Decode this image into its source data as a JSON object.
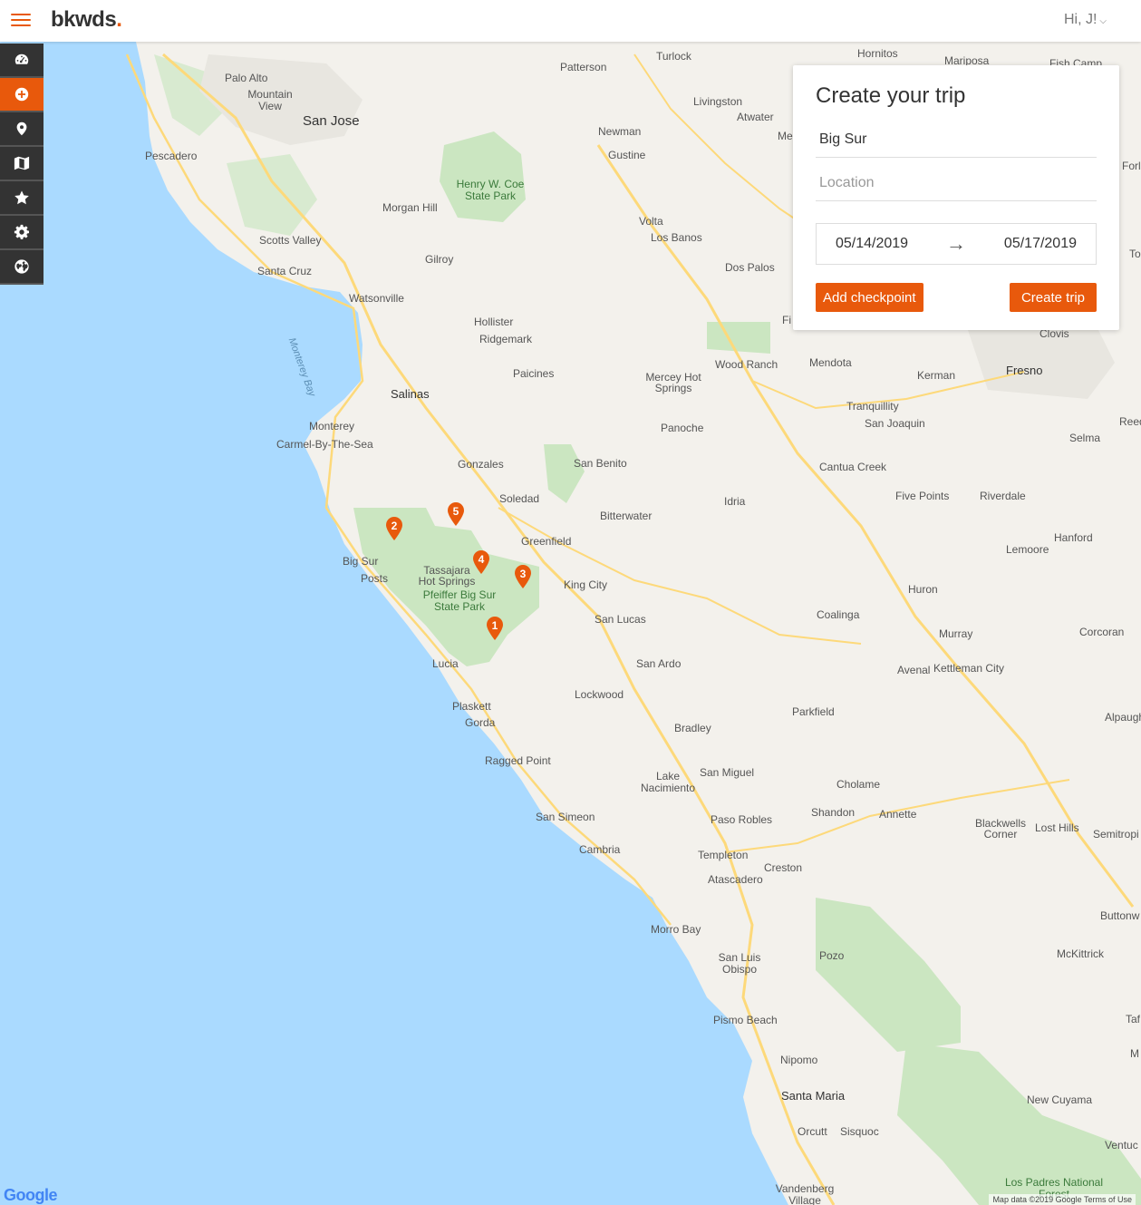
{
  "header": {
    "menu_icon": "hamburger-icon",
    "logo_text": "bkwds",
    "logo_dot": ".",
    "greeting": "Hi, J!",
    "accent_color": "#e8590c"
  },
  "sidebar": {
    "items": [
      {
        "name": "dashboard",
        "icon": "speedometer-icon",
        "active": false
      },
      {
        "name": "create-trip",
        "icon": "plus-circle-icon",
        "active": true
      },
      {
        "name": "locations",
        "icon": "map-marker-icon",
        "active": false
      },
      {
        "name": "maps",
        "icon": "map-icon",
        "active": false
      },
      {
        "name": "favorites",
        "icon": "star-icon",
        "active": false
      },
      {
        "name": "settings",
        "icon": "gear-icon",
        "active": false
      },
      {
        "name": "explore",
        "icon": "globe-icon",
        "active": false
      }
    ]
  },
  "trip_panel": {
    "title": "Create your trip",
    "trip_name_value": "Big Sur",
    "location_placeholder": "Location",
    "start_date": "05/14/2019",
    "end_date": "05/17/2019",
    "arrow": "→",
    "add_checkpoint_label": "Add checkpoint",
    "create_trip_label": "Create trip"
  },
  "map": {
    "pins": [
      "1",
      "2",
      "3",
      "4",
      "5"
    ],
    "labels": {
      "turlock": "Turlock",
      "patterson": "Patterson",
      "palo_alto": "Palo Alto",
      "mountain_view": "Mountain View",
      "san_jose": "San Jose",
      "pescadero": "Pescadero",
      "morgan_hill": "Morgan Hill",
      "henry_coe": "Henry W. Coe State Park",
      "scotts_valley": "Scotts Valley",
      "santa_cruz": "Santa Cruz",
      "gilroy": "Gilroy",
      "watsonville": "Watsonville",
      "hollister": "Hollister",
      "ridgemark": "Ridgemark",
      "monterey_bay": "Monterey Bay",
      "paicines": "Paicines",
      "salinas": "Salinas",
      "monterey": "Monterey",
      "carmel": "Carmel-By-The-Sea",
      "gonzales": "Gonzales",
      "soledad": "Soledad",
      "san_benito": "San Benito",
      "bitterwater": "Bitterwater",
      "greenfield": "Greenfield",
      "big_sur": "Big Sur",
      "posts": "Posts",
      "tassajara": "Tassajara Hot Springs",
      "pfeiffer": "Pfeiffer Big Sur State Park",
      "king_city": "King City",
      "san_lucas": "San Lucas",
      "lucia": "Lucia",
      "san_ardo": "San Ardo",
      "lockwood": "Lockwood",
      "plaskett": "Plaskett",
      "gorda": "Gorda",
      "ragged_point": "Ragged Point",
      "bradley": "Bradley",
      "san_miguel": "San Miguel",
      "lake_nacimiento": "Lake Nacimiento",
      "san_simeon": "San Simeon",
      "paso_robles": "Paso Robles",
      "cambria": "Cambria",
      "templeton": "Templeton",
      "creston": "Creston",
      "atascadero": "Atascadero",
      "morro_bay": "Morro Bay",
      "san_luis_obispo": "San Luis Obispo",
      "pozo": "Pozo",
      "pismo_beach": "Pismo Beach",
      "nipomo": "Nipomo",
      "santa_maria": "Santa Maria",
      "orcutt": "Orcutt",
      "sisquoc": "Sisquoc",
      "vandenberg": "Vandenberg Village",
      "los_padres": "Los Padres National Forest",
      "newman": "Newman",
      "gustine": "Gustine",
      "livingston": "Livingston",
      "atwater": "Atwater",
      "volta": "Volta",
      "los_banos": "Los Banos",
      "dos_palos": "Dos Palos",
      "mercey": "Mercey Hot Springs",
      "wood_ranch": "Wood Ranch",
      "panoche": "Panoche",
      "idria": "Idria",
      "mendota": "Mendota",
      "kerman": "Kerman",
      "fresno": "Fresno",
      "clovis": "Clovis",
      "tranquillity": "Tranquillity",
      "san_joaquin": "San Joaquin",
      "cantua_creek": "Cantua Creek",
      "five_points": "Five Points",
      "riverdale": "Riverdale",
      "selma": "Selma",
      "hanford": "Hanford",
      "lemoore": "Lemoore",
      "huron": "Huron",
      "coalinga": "Coalinga",
      "murray": "Murray",
      "avenal": "Avenal",
      "kettleman": "Kettleman City",
      "corcoran": "Corcoran",
      "parkfield": "Parkfield",
      "cholame": "Cholame",
      "shandon": "Shandon",
      "annette": "Annette",
      "blackwells": "Blackwells Corner",
      "lost_hills": "Lost Hills",
      "mckittrick": "McKittrick",
      "new_cuyama": "New Cuyama",
      "hornitos": "Hornitos",
      "mariposa": "Mariposa",
      "fish_camp": "Fish Camp",
      "buttonw": "Buttonw",
      "semitropi": "Semitropi",
      "alpaugh": "Alpaugh",
      "reed": "Reed",
      "ventuc": "Ventuc",
      "fort": "Forl",
      "me": "Me",
      "fi": "Fi",
      "to": "To",
      "taf": "Taf",
      "m_edge": "M"
    },
    "google_logo": "Google",
    "attribution": "Map data ©2019 Google   Terms of Use",
    "water_color": "#aadaff",
    "land_color": "#f3f1ec",
    "park_color": "#cbe6c1"
  }
}
